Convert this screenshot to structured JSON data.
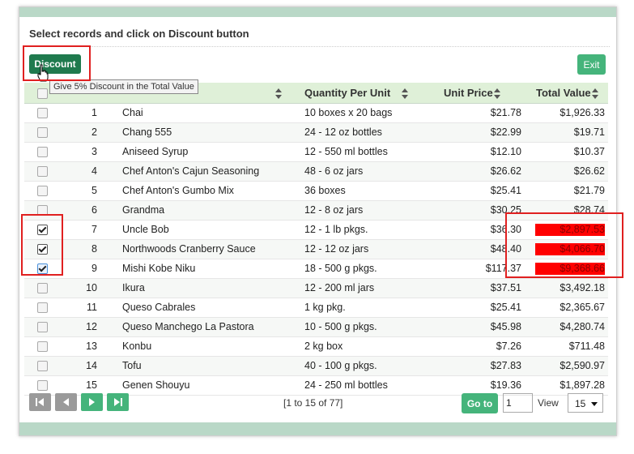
{
  "instruction": "Select records and click on Discount button",
  "buttons": {
    "discount": "Discount",
    "exit": "Exit",
    "goto": "Go to"
  },
  "tooltip": "Give 5% Discount in the Total Value",
  "columns": {
    "quantity": "Quantity Per Unit",
    "unit_price": "Unit Price",
    "total_value": "Total Value"
  },
  "rows": [
    {
      "num": "1",
      "name": "Chai",
      "qty": "10 boxes x 20 bags",
      "price": "$21.78",
      "total": "$1,926.33",
      "checked": false,
      "highlight": false
    },
    {
      "num": "2",
      "name": "Chang 555",
      "qty": "24 - 12 oz bottles",
      "price": "$22.99",
      "total": "$19.71",
      "checked": false,
      "highlight": false
    },
    {
      "num": "3",
      "name": "Aniseed Syrup",
      "qty": "12 - 550 ml bottles",
      "price": "$12.10",
      "total": "$10.37",
      "checked": false,
      "highlight": false
    },
    {
      "num": "4",
      "name": "Chef Anton's Cajun Seasoning",
      "qty": "48 - 6 oz jars",
      "price": "$26.62",
      "total": "$26.62",
      "checked": false,
      "highlight": false
    },
    {
      "num": "5",
      "name": "Chef Anton's Gumbo Mix",
      "qty": "36 boxes",
      "price": "$25.41",
      "total": "$21.79",
      "checked": false,
      "highlight": false
    },
    {
      "num": "6",
      "name": "Grandma",
      "qty": "12 - 8 oz jars",
      "price": "$30.25",
      "total": "$28.74",
      "checked": false,
      "highlight": false
    },
    {
      "num": "7",
      "name": "Uncle Bob",
      "qty": "12 - 1 lb pkgs.",
      "price": "$36.30",
      "total": "$2,897.53",
      "checked": true,
      "highlight": true
    },
    {
      "num": "8",
      "name": "Northwoods Cranberry Sauce",
      "qty": "12 - 12 oz jars",
      "price": "$48.40",
      "total": "$4,066.70",
      "checked": true,
      "highlight": true
    },
    {
      "num": "9",
      "name": "Mishi Kobe Niku",
      "qty": "18 - 500 g pkgs.",
      "price": "$117.37",
      "total": "$9,368.66",
      "checked": true,
      "highlight": true
    },
    {
      "num": "10",
      "name": "Ikura",
      "qty": "12 - 200 ml jars",
      "price": "$37.51",
      "total": "$3,492.18",
      "checked": false,
      "highlight": false
    },
    {
      "num": "11",
      "name": "Queso Cabrales",
      "qty": "1 kg pkg.",
      "price": "$25.41",
      "total": "$2,365.67",
      "checked": false,
      "highlight": false
    },
    {
      "num": "12",
      "name": "Queso Manchego La Pastora",
      "qty": "10 - 500 g pkgs.",
      "price": "$45.98",
      "total": "$4,280.74",
      "checked": false,
      "highlight": false
    },
    {
      "num": "13",
      "name": "Konbu",
      "qty": "2 kg box",
      "price": "$7.26",
      "total": "$711.48",
      "checked": false,
      "highlight": false
    },
    {
      "num": "14",
      "name": "Tofu",
      "qty": "40 - 100 g pkgs.",
      "price": "$27.83",
      "total": "$2,590.97",
      "checked": false,
      "highlight": false
    },
    {
      "num": "15",
      "name": "Genen Shouyu",
      "qty": "24 - 250 ml bottles",
      "price": "$19.36",
      "total": "$1,897.28",
      "checked": false,
      "highlight": false
    }
  ],
  "pager": {
    "info": "[1 to 15 of 77]",
    "page_value": "1",
    "view_label": "View",
    "view_value": "15"
  },
  "icons": {
    "first": "first-page-icon",
    "prev": "prev-page-icon",
    "next": "next-page-icon",
    "last": "last-page-icon",
    "cursor": "hand-cursor-icon"
  },
  "colors": {
    "accent_dark": "#1f7a4e",
    "accent": "#45b47b",
    "header_bg": "#dff0d8",
    "highlight": "#ff0000",
    "annotation": "#e02020"
  }
}
